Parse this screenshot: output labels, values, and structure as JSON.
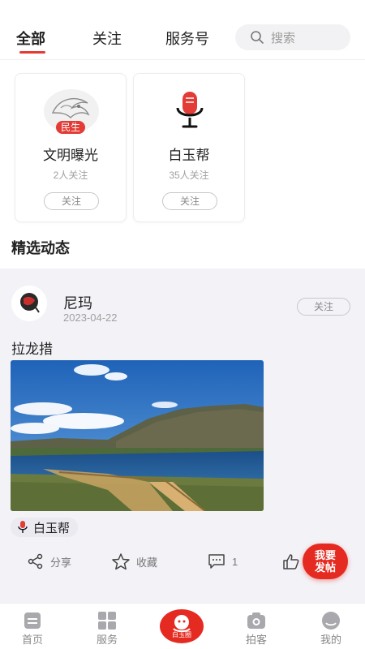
{
  "tabs": [
    {
      "label": "全部",
      "active": true
    },
    {
      "label": "关注",
      "active": false
    },
    {
      "label": "服务号",
      "active": false
    }
  ],
  "search": {
    "placeholder": "搜索",
    "icon": "search-icon"
  },
  "service_cards": [
    {
      "name": "文明曝光",
      "badge": "民生",
      "followers": "2人关注",
      "follow_label": "关注",
      "icon": "dragon-logo"
    },
    {
      "name": "白玉帮",
      "badge": "",
      "followers": "35人关注",
      "follow_label": "关注",
      "icon": "microphone-icon"
    }
  ],
  "section": {
    "title": "精选动态"
  },
  "post": {
    "author": "尼玛",
    "date": "2023-04-22",
    "follow_label": "关注",
    "text": "拉龙措",
    "channel": "白玉帮",
    "actions": {
      "share": "分享",
      "favorite": "收藏",
      "comments": "1"
    }
  },
  "fab": {
    "line1": "我要",
    "line2": "发帖"
  },
  "bottom_nav": [
    {
      "label": "首页",
      "icon": "home-icon"
    },
    {
      "label": "服务",
      "icon": "grid-icon"
    },
    {
      "label": "白玉圈",
      "icon": "circle-icon"
    },
    {
      "label": "拍客",
      "icon": "camera-icon"
    },
    {
      "label": "我的",
      "icon": "profile-icon"
    }
  ],
  "colors": {
    "accent": "#e33b36",
    "feed_bg": "#f3f2f7"
  }
}
